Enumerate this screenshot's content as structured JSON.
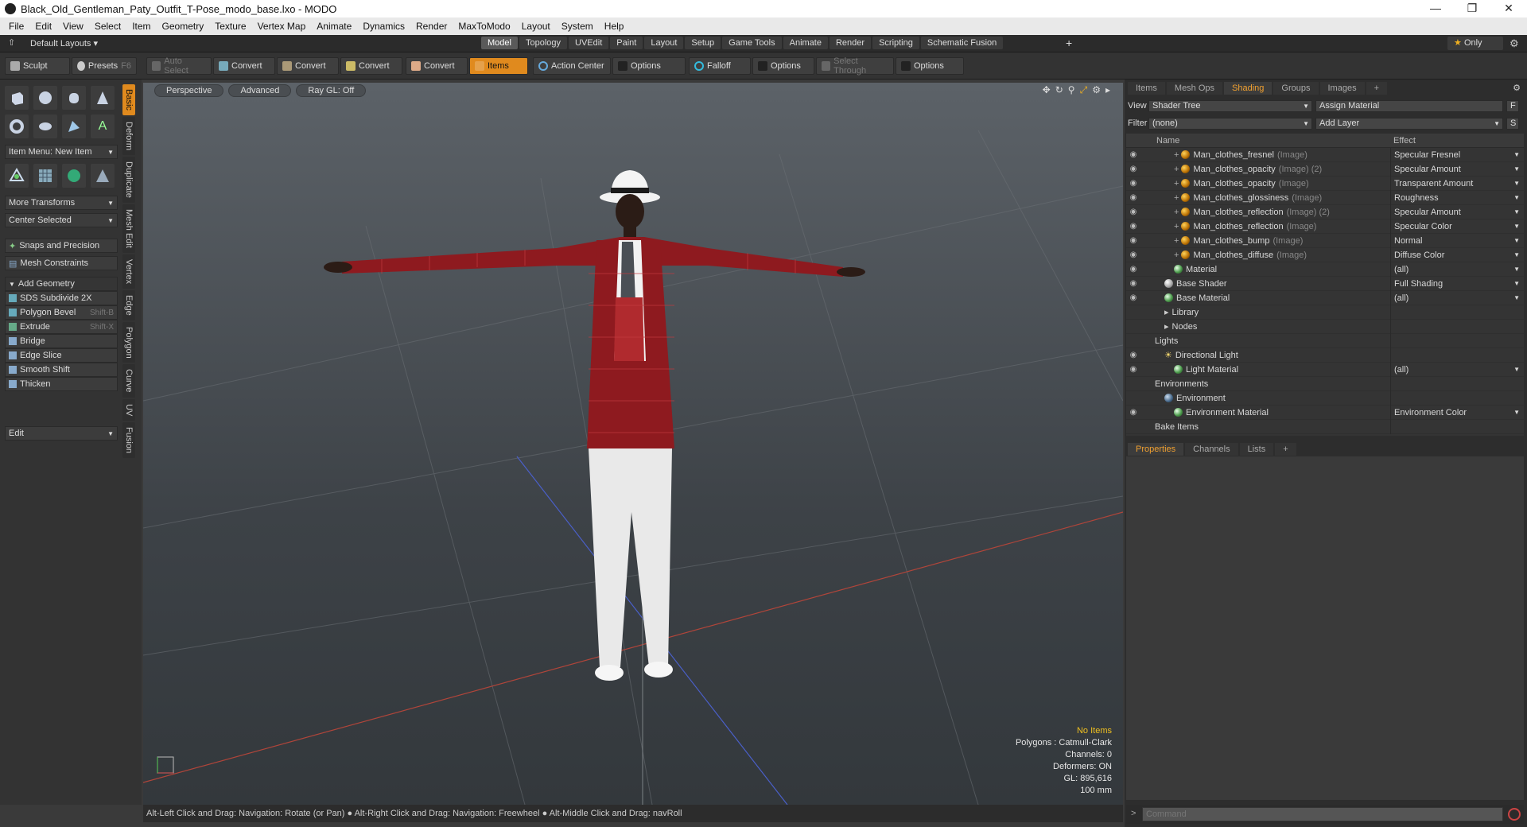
{
  "window": {
    "title": "Black_Old_Gentleman_Paty_Outfit_T-Pose_modo_base.lxo - MODO"
  },
  "menu": [
    "File",
    "Edit",
    "View",
    "Select",
    "Item",
    "Geometry",
    "Texture",
    "Vertex Map",
    "Animate",
    "Dynamics",
    "Render",
    "MaxToModo",
    "Layout",
    "System",
    "Help"
  ],
  "layouts": {
    "label": "Default Layouts ▾"
  },
  "mode_tabs": [
    "Model",
    "Topology",
    "UVEdit",
    "Paint",
    "Layout",
    "Setup",
    "Game Tools",
    "Animate",
    "Render",
    "Scripting",
    "Schematic Fusion"
  ],
  "only_label": "Only",
  "toolbar": {
    "sculpt": "Sculpt",
    "presets": "Presets",
    "presets_key": "F6",
    "auto_select": "Auto Select",
    "convert1": "Convert",
    "convert2": "Convert",
    "convert3": "Convert",
    "convert4": "Convert",
    "items": "Items",
    "action_center": "Action Center",
    "options1": "Options",
    "falloff": "Falloff",
    "options2": "Options",
    "select_through": "Select Through",
    "options3": "Options"
  },
  "left": {
    "item_menu": "Item Menu: New Item",
    "more_transforms": "More Transforms",
    "center_selected": "Center Selected",
    "snaps": "Snaps and Precision",
    "mesh_constraints": "Mesh Constraints",
    "add_geometry": "Add Geometry",
    "tools": [
      {
        "label": "SDS Subdivide 2X",
        "key": ""
      },
      {
        "label": "Polygon Bevel",
        "key": "Shift-B"
      },
      {
        "label": "Extrude",
        "key": "Shift-X"
      },
      {
        "label": "Bridge",
        "key": ""
      },
      {
        "label": "Edge Slice",
        "key": ""
      },
      {
        "label": "Smooth Shift",
        "key": ""
      },
      {
        "label": "Thicken",
        "key": ""
      }
    ],
    "edit": "Edit",
    "vtabs": [
      "Basic",
      "Deform",
      "Duplicate",
      "Mesh Edit",
      "Vertex",
      "Edge",
      "Polygon",
      "Curve",
      "UV",
      "Fusion"
    ]
  },
  "viewport": {
    "tabs": [
      "Perspective",
      "Advanced",
      "Ray GL: Off"
    ],
    "info": {
      "selection": "No Items",
      "polygons": "Polygons : Catmull-Clark",
      "channels": "Channels: 0",
      "deformers": "Deformers: ON",
      "gl": "GL: 895,616",
      "scale": "100 mm"
    }
  },
  "status": "Alt-Left Click and Drag: Navigation: Rotate (or Pan) ● Alt-Right Click and Drag: Navigation: Freewheel ● Alt-Middle Click and Drag: navRoll",
  "right": {
    "tabs": [
      "Items",
      "Mesh Ops",
      "Shading",
      "Groups",
      "Images"
    ],
    "view_label": "View",
    "view_value": "Shader Tree",
    "assign_material": "Assign Material",
    "f_btn": "F",
    "filter_label": "Filter",
    "filter_value": "(none)",
    "add_layer": "Add Layer",
    "s_btn": "S",
    "col_name": "Name",
    "col_effect": "Effect",
    "rows": [
      {
        "name": "Man_clothes_fresnel",
        "tag": "(Image)",
        "effect": "Specular Fresnel",
        "kind": "img",
        "indent": 3,
        "eye": true
      },
      {
        "name": "Man_clothes_opacity",
        "tag": "(Image) (2)",
        "effect": "Specular Amount",
        "kind": "img",
        "indent": 3,
        "eye": true
      },
      {
        "name": "Man_clothes_opacity",
        "tag": "(Image)",
        "effect": "Transparent Amount",
        "kind": "img",
        "indent": 3,
        "eye": true
      },
      {
        "name": "Man_clothes_glossiness",
        "tag": "(Image)",
        "effect": "Roughness",
        "kind": "img",
        "indent": 3,
        "eye": true
      },
      {
        "name": "Man_clothes_reflection",
        "tag": "(Image) (2)",
        "effect": "Specular Amount",
        "kind": "img",
        "indent": 3,
        "eye": true
      },
      {
        "name": "Man_clothes_reflection",
        "tag": "(Image)",
        "effect": "Specular Color",
        "kind": "img",
        "indent": 3,
        "eye": true
      },
      {
        "name": "Man_clothes_bump",
        "tag": "(Image)",
        "effect": "Normal",
        "kind": "img",
        "indent": 3,
        "eye": true
      },
      {
        "name": "Man_clothes_diffuse",
        "tag": "(Image)",
        "effect": "Diffuse Color",
        "kind": "img",
        "indent": 3,
        "eye": true
      },
      {
        "name": "Material",
        "tag": "",
        "effect": "(all)",
        "kind": "mat",
        "indent": 3,
        "eye": true
      },
      {
        "name": "Base Shader",
        "tag": "",
        "effect": "Full Shading",
        "kind": "shd",
        "indent": 2,
        "eye": true
      },
      {
        "name": "Base Material",
        "tag": "",
        "effect": "(all)",
        "kind": "mat",
        "indent": 2,
        "eye": true
      },
      {
        "name": "Library",
        "tag": "",
        "effect": "",
        "kind": "folder",
        "indent": 2,
        "eye": false
      },
      {
        "name": "Nodes",
        "tag": "",
        "effect": "",
        "kind": "folder",
        "indent": 2,
        "eye": false
      },
      {
        "name": "Lights",
        "tag": "",
        "effect": "",
        "kind": "none",
        "indent": 1,
        "eye": false
      },
      {
        "name": "Directional Light",
        "tag": "",
        "effect": "",
        "kind": "light",
        "indent": 2,
        "eye": true
      },
      {
        "name": "Light Material",
        "tag": "",
        "effect": "(all)",
        "kind": "mat",
        "indent": 3,
        "eye": true
      },
      {
        "name": "Environments",
        "tag": "",
        "effect": "",
        "kind": "none",
        "indent": 1,
        "eye": false
      },
      {
        "name": "Environment",
        "tag": "",
        "effect": "",
        "kind": "env",
        "indent": 2,
        "eye": false
      },
      {
        "name": "Environment Material",
        "tag": "",
        "effect": "Environment Color",
        "kind": "mat",
        "indent": 3,
        "eye": true
      },
      {
        "name": "Bake Items",
        "tag": "",
        "effect": "",
        "kind": "none",
        "indent": 1,
        "eye": false
      }
    ],
    "lower_tabs": [
      "Properties",
      "Channels",
      "Lists"
    ],
    "command_placeholder": "Command"
  },
  "colors": {
    "accent": "#e08a1e",
    "jacket": "#8e1a1f",
    "pants": "#e8e8e8"
  }
}
